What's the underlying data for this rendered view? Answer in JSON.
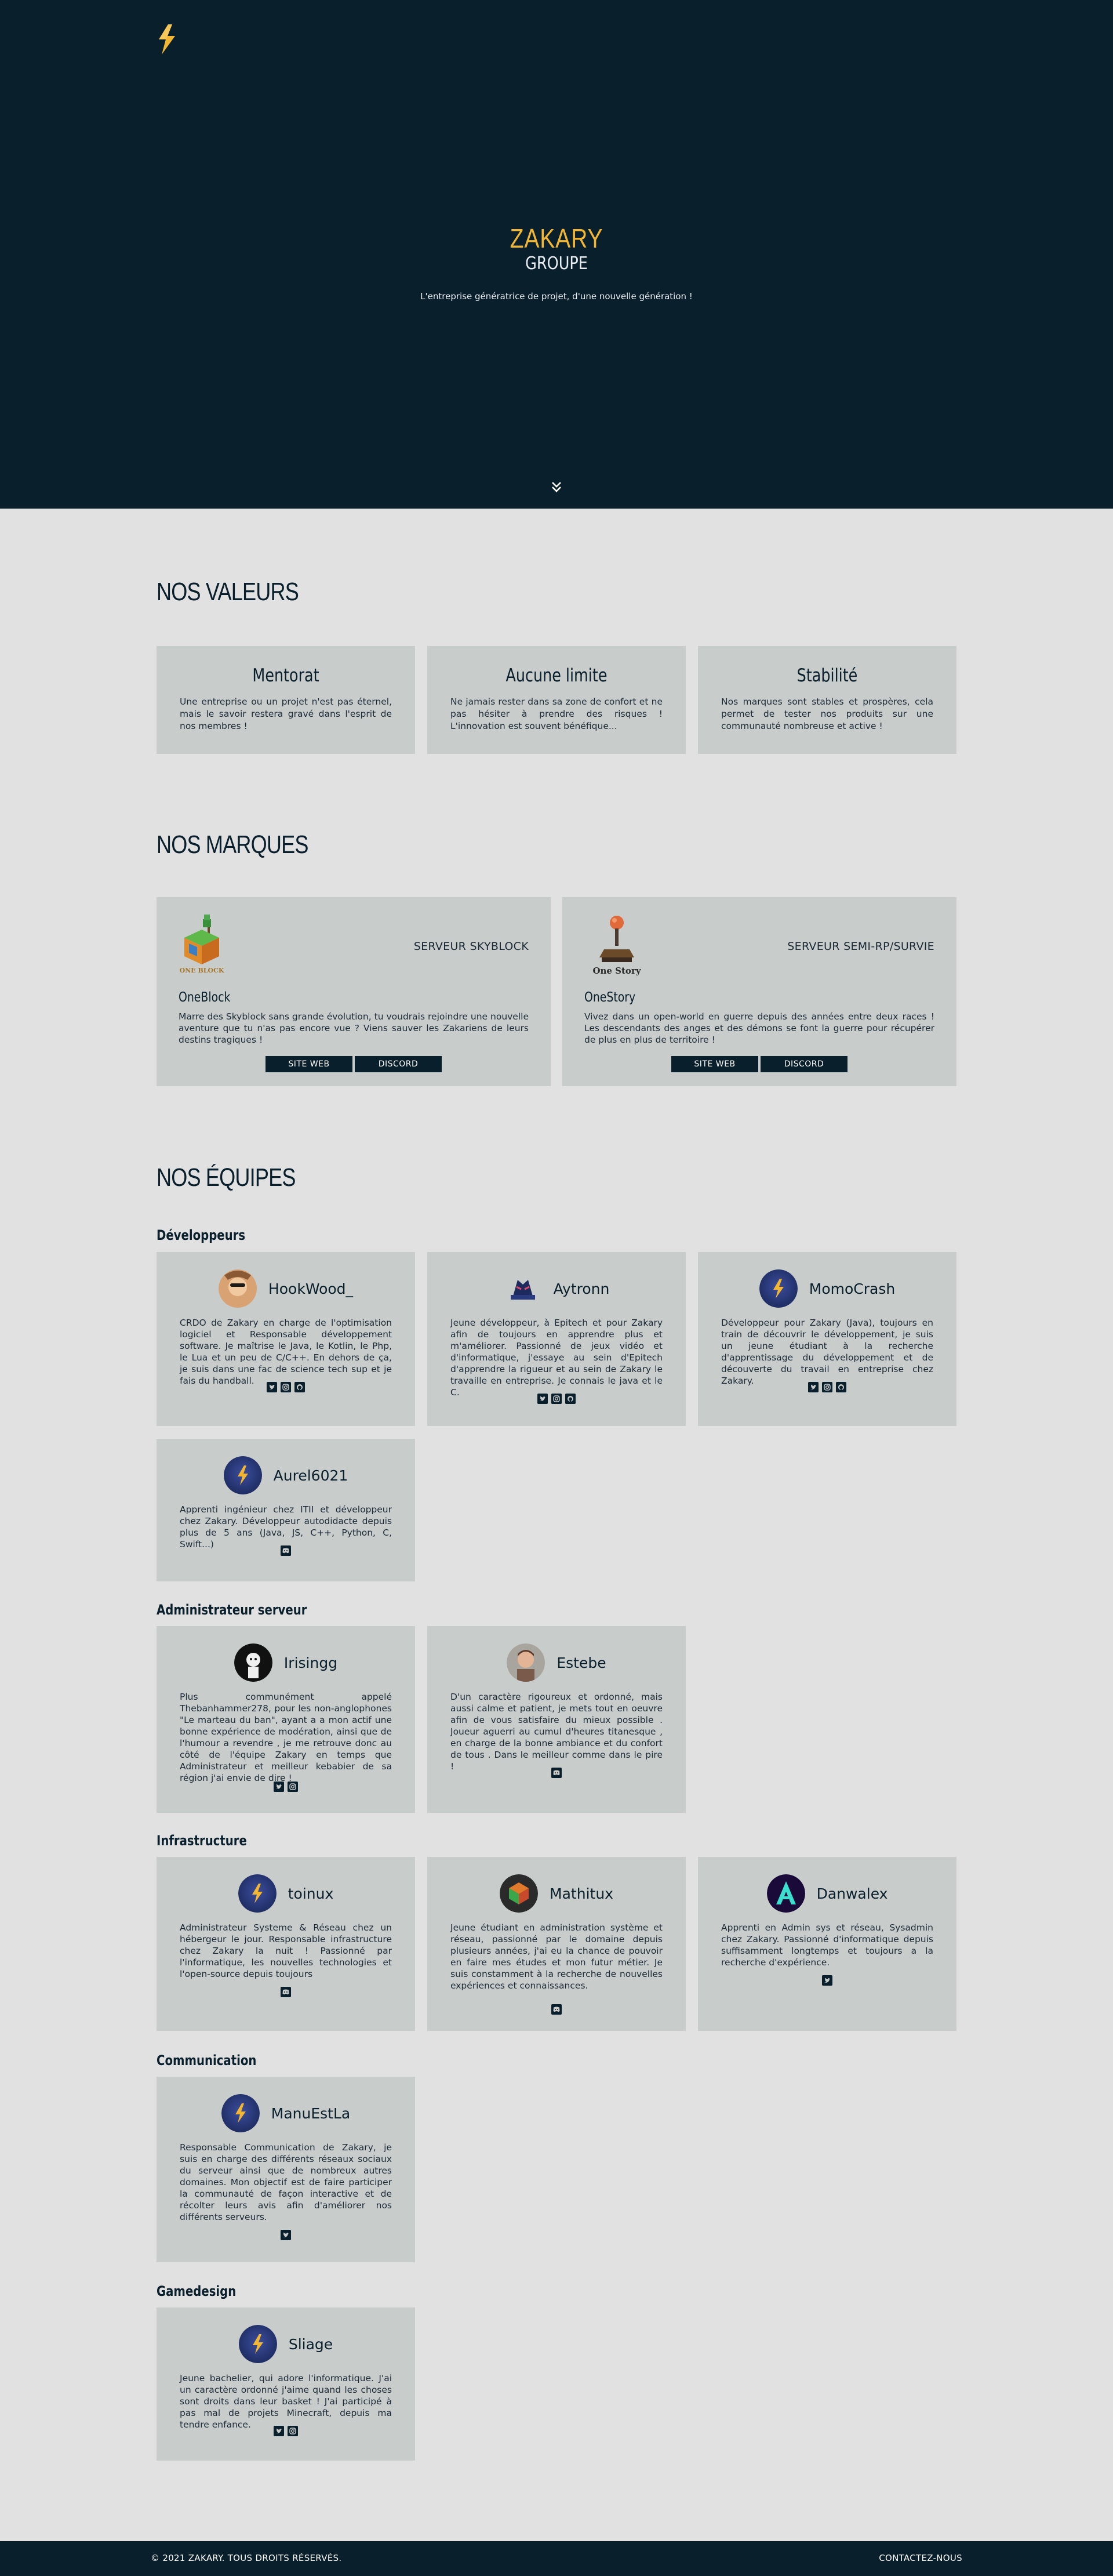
{
  "hero": {
    "title": "ZAKARY",
    "subtitle": "GROUPE",
    "tagline": "L'entreprise génératrice de projet, d'une nouvelle génération !"
  },
  "valeurs": {
    "title": "NOS VALEURS",
    "items": [
      {
        "title": "Mentorat",
        "text": "Une entreprise ou un projet n'est pas éternel, mais le savoir restera gravé dans l'esprit de nos membres !"
      },
      {
        "title": "Aucune limite",
        "text": "Ne jamais rester dans sa zone de confort et ne pas hésiter à prendre des risques ! L'innovation est souvent bénéfique..."
      },
      {
        "title": "Stabilité",
        "text": "Nos marques sont stables et prospères, cela permet de tester nos produits sur une communauté nombreuse et active !"
      }
    ]
  },
  "marques": {
    "title": "NOS MARQUES",
    "items": [
      {
        "type": "SERVEUR SKYBLOCK",
        "name": "OneBlock",
        "logo_text": "ONE BLOCK",
        "text": "Marre des Skyblock sans grande évolution, tu voudrais rejoindre une nouvelle aventure que tu n'as pas encore vue ? Viens sauver les Zakariens de leurs destins tragiques !",
        "btn1": "SITE WEB",
        "btn2": "DISCORD"
      },
      {
        "type": "SERVEUR SEMI-RP/SURVIE",
        "name": "OneStory",
        "logo_text": "One Story",
        "text": "Vivez dans un open-world en guerre depuis des années entre deux races ! Les descendants des anges et des démons se font la guerre pour récupérer de plus en plus de territoire !",
        "btn1": "SITE WEB",
        "btn2": "DISCORD"
      }
    ]
  },
  "equipes": {
    "title": "NOS ÉQUIPES",
    "groups": [
      {
        "title": "Développeurs",
        "members": [
          {
            "name": "HookWood_",
            "text": "CRDO de Zakary en charge de l'optimisation logiciel et Responsable développement software. Je maîtrise le Java, le Kotlin, le Php, le Lua et un peu de C/C++. En dehors de ça, je suis dans une fac de science tech sup et je fais du handball."
          },
          {
            "name": "Aytronn",
            "text": "Jeune développeur, à Epitech et pour Zakary afin de toujours en apprendre plus et m'améliorer. Passionné de jeux vidéo et d'informatique, j'essaye au sein d'Epitech d'apprendre la rigueur et au sein de Zakary le travaille en entreprise. Je connais le java et le C."
          },
          {
            "name": "MomoCrash",
            "text": "Développeur pour Zakary (Java), toujours en train de découvrir le développement, je suis un jeune étudiant à la recherche d'apprentissage du développement et de découverte du travail en entreprise chez Zakary."
          },
          {
            "name": "Aurel6021",
            "text": "Apprenti ingénieur chez ITII et développeur chez Zakary. Développeur autodidacte depuis plus de 5 ans (Java, JS, C++, Python, C, Swift...)"
          }
        ]
      },
      {
        "title": "Administrateur serveur",
        "members": [
          {
            "name": "Irisingg",
            "text": "Plus communément appelé Thebanhammer278, pour les non-anglophones \"Le marteau du ban\", ayant a a mon actif une bonne expérience de modération, ainsi que de l'humour a revendre , je me retrouve donc au côté de l'équipe Zakary en temps que Administrateur et meilleur kebabier de sa région j'ai envie de dire !"
          },
          {
            "name": "Estebe",
            "text": "D'un caractère rigoureux et ordonné, mais aussi calme et patient, je mets tout en oeuvre afin de vous satisfaire du mieux possible . Joueur aguerri au cumul d'heures titanesque , en charge de la bonne ambiance et du confort de tous . Dans le meilleur comme dans le pire !"
          }
        ]
      },
      {
        "title": "Infrastructure",
        "members": [
          {
            "name": "toinux",
            "text": "Administrateur Systeme & Réseau chez un hébergeur le jour. Responsable infrastructure chez Zakary la nuit ! Passionné par l'informatique, les nouvelles technologies et l'open-source depuis toujours"
          },
          {
            "name": "Mathitux",
            "text": "Jeune étudiant en administration système et réseau, passionné par le domaine depuis plusieurs années, j'ai eu la chance de pouvoir en faire mes études et mon futur métier. Je suis constamment à la recherche de nouvelles expériences et connaissances."
          },
          {
            "name": "Danwalex",
            "text": "Apprenti en Admin sys et réseau, Sysadmin chez Zakary. Passionné d'informatique depuis suffisamment longtemps et toujours a la recherche d'expérience."
          }
        ]
      },
      {
        "title": "Communication",
        "members": [
          {
            "name": "ManuEstLa",
            "text": "Responsable Communication de Zakary, je suis en charge des différents réseaux sociaux du serveur ainsi que de nombreux autres domaines. Mon objectif est de faire participer la communauté de façon interactive et de récolter leurs avis afin d'améliorer nos différents serveurs."
          }
        ]
      },
      {
        "title": "Gamedesign",
        "members": [
          {
            "name": "Sliage",
            "text": "Jeune bachelier, qui adore l'informatique. J'ai un caractère ordonné j'aime quand les choses sont droits dans leur basket ! J'ai participé à pas mal de projets Minecraft, depuis ma tendre enfance."
          }
        ]
      }
    ]
  },
  "footer": {
    "copyright": "© 2021 ZAKARY. TOUS DROITS RÉSERVÉS.",
    "contact": "CONTACTEZ-NOUS"
  },
  "colors": {
    "dark": "#0a1f2c",
    "accent": "#f2b632",
    "card": "#c8cccb",
    "page": "#e1e1e1"
  }
}
